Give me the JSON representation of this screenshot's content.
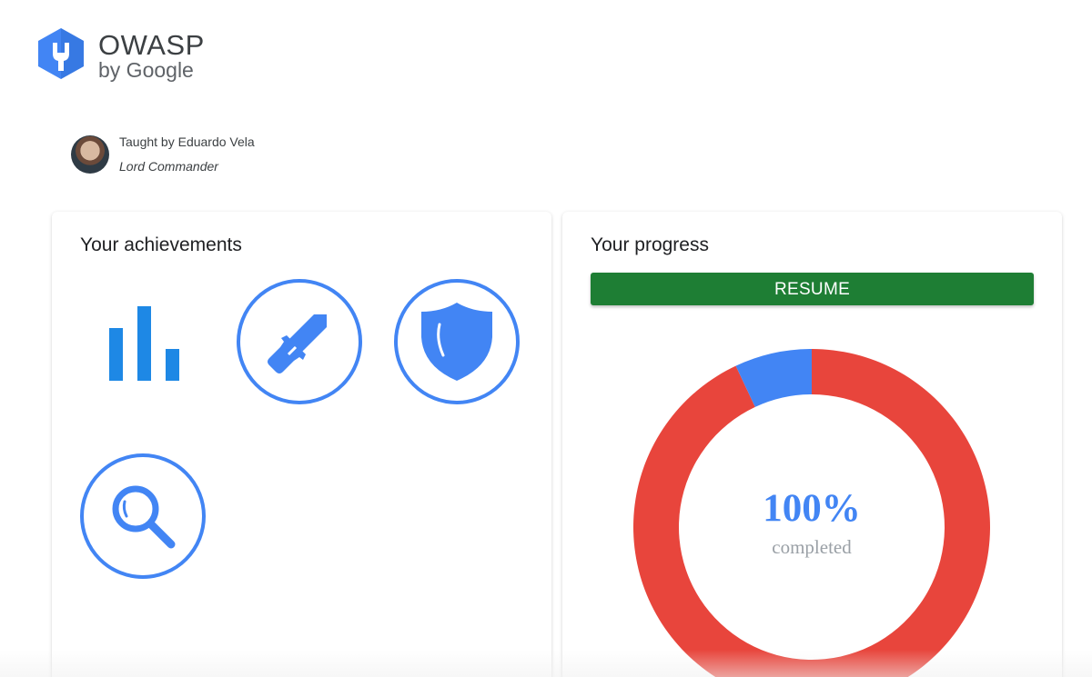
{
  "header": {
    "logo_title": "OWASP",
    "logo_subtitle": "by Google",
    "logo_icon": "owasp-hexagon-logo-icon"
  },
  "instructor": {
    "taught_by": "Taught by Eduardo Vela",
    "role": "Lord Commander"
  },
  "achievements": {
    "title": "Your achievements",
    "badges": [
      {
        "icon": "bar-chart-icon"
      },
      {
        "icon": "sword-icon"
      },
      {
        "icon": "shield-icon"
      },
      {
        "icon": "magnifier-icon"
      }
    ]
  },
  "progress": {
    "title": "Your progress",
    "resume_label": "RESUME",
    "percent_label": "100%",
    "completed_label": "completed",
    "colors": {
      "accent_blue": "#4285f4",
      "ring_red": "#e8453c",
      "button_green": "#1e7e34"
    }
  },
  "chart_data": {
    "type": "pie",
    "segments": [
      {
        "value": 93,
        "color": "#e8453c"
      },
      {
        "value": 7,
        "color": "#4285f4"
      }
    ]
  }
}
